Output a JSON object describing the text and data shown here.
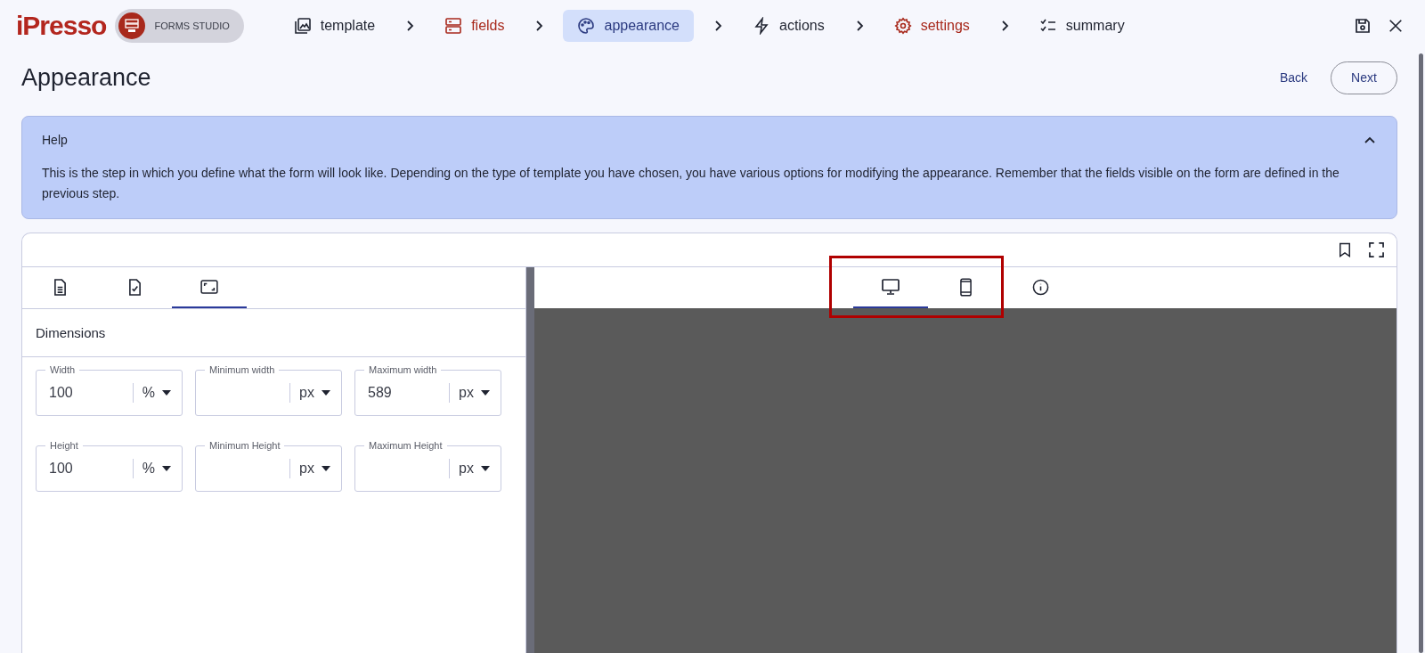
{
  "brand": {
    "logo": "iPresso",
    "badge": "FORMS STUDIO"
  },
  "steps": [
    {
      "kind": "template",
      "label": "template",
      "selected": false,
      "color": "#1f2330"
    },
    {
      "kind": "fields",
      "label": "fields",
      "selected": false,
      "color": "#a8291c"
    },
    {
      "kind": "appearance",
      "label": "appearance",
      "selected": true,
      "color": "#2b3a80"
    },
    {
      "kind": "actions",
      "label": "actions",
      "selected": false,
      "color": "#1f2330"
    },
    {
      "kind": "settings",
      "label": "settings",
      "selected": false,
      "color": "#a8291c"
    },
    {
      "kind": "summary",
      "label": "summary",
      "selected": false,
      "color": "#1f2330"
    }
  ],
  "page_title": "Appearance",
  "buttons": {
    "back": "Back",
    "next": "Next"
  },
  "help": {
    "title": "Help",
    "expanded": true,
    "text": "This is the step in which you define what the form will look like. Depending on the type of template you have chosen, you have various options for modifying the appearance. Remember that the fields visible on the form are defined in the previous step."
  },
  "left_tabs": [
    {
      "kind": "document",
      "selected": false
    },
    {
      "kind": "checklist",
      "selected": false
    },
    {
      "kind": "dimensions",
      "selected": true
    }
  ],
  "section_title": "Dimensions",
  "field_rows": [
    [
      {
        "label": "Width",
        "value": "100",
        "unit": "%"
      },
      {
        "label": "Minimum width",
        "unit": "px"
      },
      {
        "label": "Maximum width",
        "value": "589",
        "unit": "px"
      }
    ],
    [
      {
        "label": "Height",
        "value": "100",
        "unit": "%"
      },
      {
        "label": "Minimum Height",
        "unit": "px"
      },
      {
        "label": "Maximum Height",
        "unit": "px"
      }
    ]
  ],
  "preview_tabs": [
    {
      "kind": "desktop",
      "selected": true
    },
    {
      "kind": "mobile",
      "selected": false
    },
    {
      "kind": "info",
      "selected": false
    }
  ]
}
